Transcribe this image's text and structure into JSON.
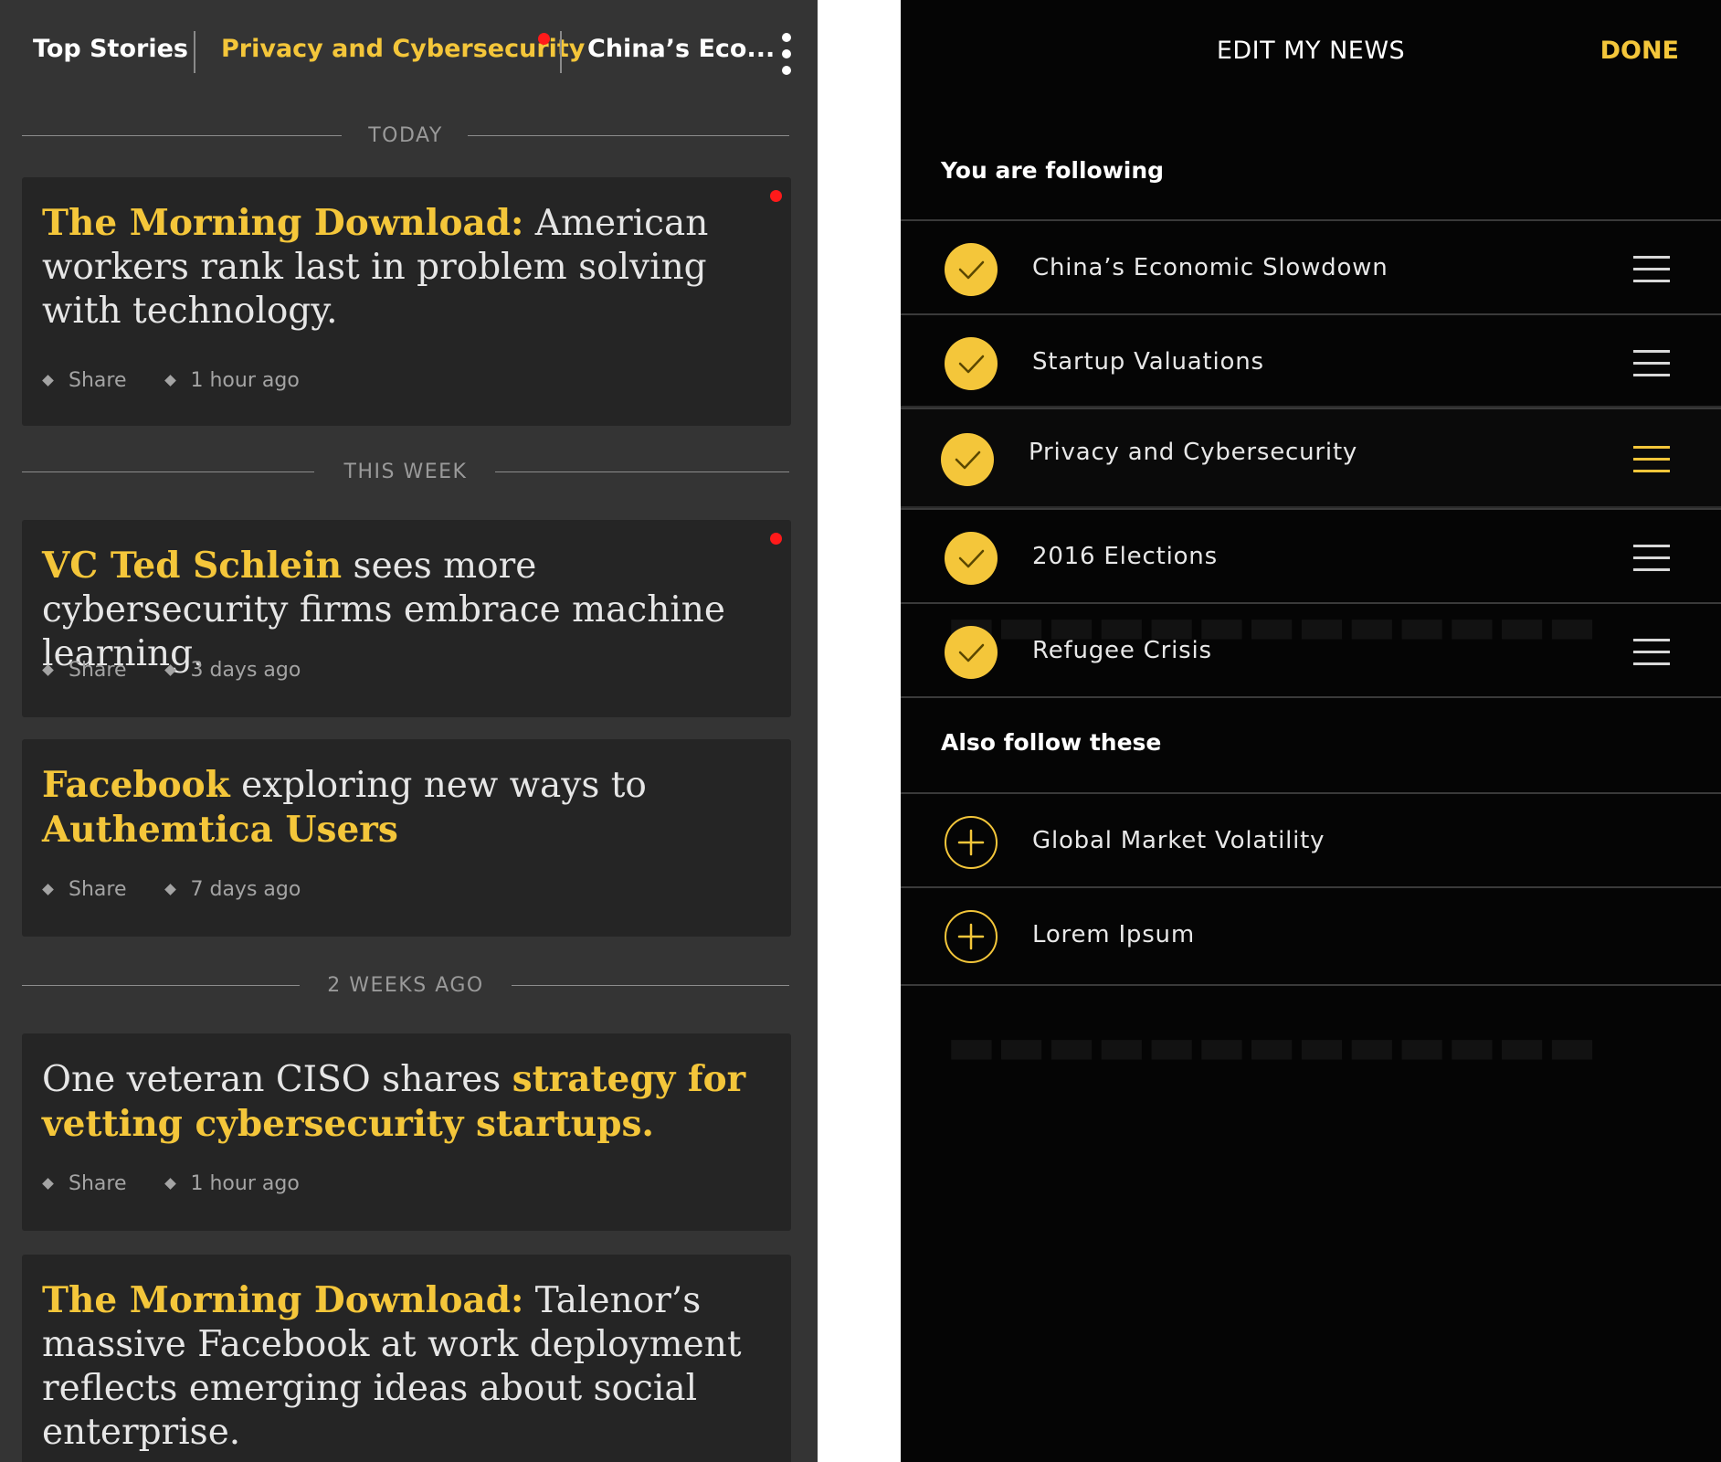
{
  "feed": {
    "tabs": [
      {
        "label": "Top Stories"
      },
      {
        "label": "Privacy and Cybersecurity"
      },
      {
        "label": "China’s Eco..."
      }
    ],
    "sections": [
      {
        "label": "TODAY"
      },
      {
        "label": "THIS WEEK"
      },
      {
        "label": "2 WEEKS AGO"
      }
    ],
    "cards": [
      {
        "hl": "The Morning Download:",
        "text": " American workers rank last in problem solving with technology.",
        "share": "Share",
        "time": "1 hour ago"
      },
      {
        "hl": "VC Ted Schlein",
        "text": " sees more cybersecurity firms embrace machine learning.",
        "share": "Share",
        "time": "3 days ago"
      },
      {
        "hl": "Facebook",
        "text": " exploring new ways to ",
        "hl2": "Authemtica Users",
        "share": "Share",
        "time": "7 days ago"
      },
      {
        "pre": "One veteran CISO shares ",
        "hl": "strategy for vetting cybersecurity startups.",
        "share": "Share",
        "time": "1 hour ago"
      },
      {
        "hl": "The Morning Download:",
        "text": " Talenor’s massive Facebook at work deployment reflects emerging ideas about social enterprise."
      }
    ]
  },
  "edit": {
    "title": "EDIT MY NEWS",
    "done": "DONE",
    "following_heading": "You are following",
    "following": [
      {
        "label": "China’s Economic Slowdown"
      },
      {
        "label": "Startup Valuations"
      },
      {
        "label": "Privacy and Cybersecurity"
      },
      {
        "label": "2016 Elections"
      },
      {
        "label": "Refugee Crisis"
      }
    ],
    "also_heading": "Also follow these",
    "also": [
      {
        "label": "Global Market Volatility"
      },
      {
        "label": "Lorem Ipsum"
      }
    ]
  },
  "colors": {
    "accent": "#f4c63a",
    "unread_dot": "#ff1a1a",
    "feed_bg": "#343434",
    "card_bg": "#252525",
    "edit_bg": "#050505"
  }
}
